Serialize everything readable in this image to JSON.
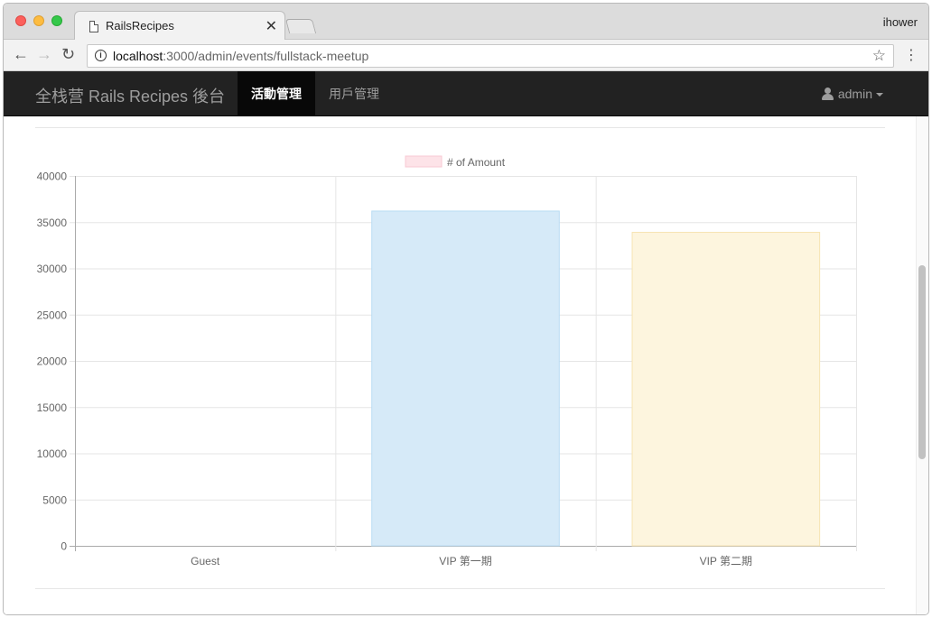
{
  "browser": {
    "tab_title": "RailsRecipes",
    "profile_name": "ihower",
    "url_host": "localhost",
    "url_rest": ":3000/admin/events/fullstack-meetup",
    "icons": {
      "back": "arrow-left-icon",
      "forward": "arrow-right-icon",
      "reload": "reload-icon",
      "info": "info-icon",
      "bookmark": "star-icon",
      "menu": "more-vert-icon",
      "close": "close-icon",
      "page": "document-icon"
    }
  },
  "navbar": {
    "brand": "全栈营 Rails Recipes 後台",
    "items": [
      {
        "label": "活動管理",
        "active": true
      },
      {
        "label": "用戶管理",
        "active": false
      }
    ],
    "user_label": "admin"
  },
  "colors": {
    "navbar_bg": "#222222",
    "navbar_active": "#080808",
    "bar_guest": "#fde3e8",
    "bar_vip1": "#d6eaf8",
    "bar_vip2": "#fdf5de",
    "bar_vip1_border": "#b9dcf3",
    "bar_vip2_border": "#f6e4b3"
  },
  "chart_data": {
    "type": "bar",
    "categories": [
      "Guest",
      "VIP 第一期",
      "VIP 第二期"
    ],
    "series": [
      {
        "name": "# of Amount",
        "values": [
          0,
          36200,
          33900
        ]
      }
    ],
    "ylim": [
      0,
      40000
    ],
    "yticks": [
      0,
      5000,
      10000,
      15000,
      20000,
      25000,
      30000,
      35000,
      40000
    ],
    "legend": "top",
    "grid": true,
    "xlabel": "",
    "ylabel": ""
  }
}
